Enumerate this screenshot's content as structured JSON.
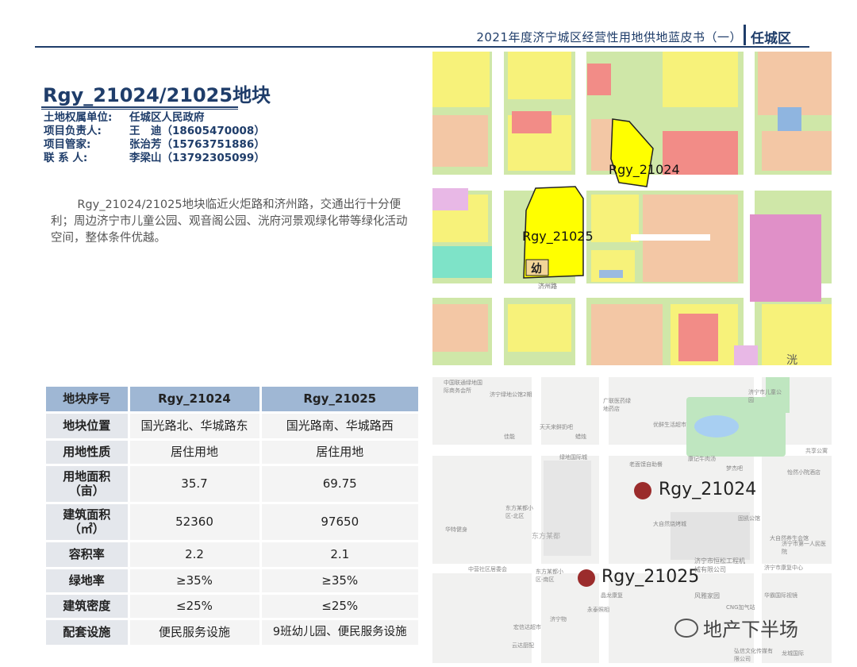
{
  "header": {
    "title": "2021年度济宁城区经营性用地供地蓝皮书（一）",
    "district": "任城区"
  },
  "plot": {
    "title": "Rgy_21024/21025地块",
    "info": [
      {
        "label": "土地权属单位:",
        "value": "任城区人民政府"
      },
      {
        "label": "项目负责人:",
        "value": "王　迪（18605470008）"
      },
      {
        "label": "项目管家:",
        "value": "张治芳（15763751886）"
      },
      {
        "label": "联 系 人:",
        "value": "李梁山（13792305099）"
      }
    ],
    "description": "Rgy_21024/21025地块临近火炬路和济州路，交通出行十分便利；周边济宁市儿童公园、观音阁公园、洸府河景观绿化带等绿化活动空间，整体条件优越。"
  },
  "table": {
    "headers": [
      "地块序号",
      "Rgy_21024",
      "Rgy_21025"
    ],
    "rows": [
      [
        "地块位置",
        "国光路北、华城路东",
        "国光路南、华城路西"
      ],
      [
        "用地性质",
        "居住用地",
        "居住用地"
      ],
      [
        "用地面积（亩）",
        "35.7",
        "69.75"
      ],
      [
        "建筑面积（㎡）",
        "52360",
        "97650"
      ],
      [
        "容积率",
        "2.2",
        "2.1"
      ],
      [
        "绿地率",
        "≥35%",
        "≥35%"
      ],
      [
        "建筑密度",
        "≤25%",
        "≤25%"
      ],
      [
        "配套设施",
        "便民服务设施",
        "9班幼儿园、便民服务设施"
      ]
    ]
  },
  "planning_map": {
    "labels": {
      "plot_a": "Rgy_21024",
      "plot_b": "Rgy_21025",
      "kindergarten": "幼",
      "river": "洸",
      "road": "济州路"
    },
    "colors": {
      "residential": "#f7f27a",
      "commercial": "#f3c7a5",
      "green": "#cfe7a8",
      "public": "#f28c87",
      "selected": "#ffff00",
      "education": "#e090c8"
    }
  },
  "location_map": {
    "labels": {
      "plot_a": "Rgy_21024",
      "plot_b": "Rgy_21025"
    },
    "pois": [
      "中国联通绿地国际商务会所",
      "济宁绿地公馆2期",
      "广联医药绿地药店",
      "天天来鲜奶吧",
      "佳能",
      "优鲜生活超市",
      "蜡烛",
      "济宁市儿童公园",
      "绿地国际城",
      "老面馍自助餐",
      "康记牛肉汤",
      "梦杰吧",
      "东方某都小区-北区",
      "东方某都",
      "大自然烧烤城",
      "固凯公馆",
      "华特健身",
      "大自然养生会馆",
      "济宁市恒松工程机械有限公司",
      "东方某都小区-南区",
      "中营社区居委会",
      "济宁市第一人民医院",
      "晶龙康复",
      "永泰照相",
      "风雅家园",
      "济宁市康复中心",
      "华霸国际视镜",
      "CNG加气站",
      "济宁物",
      "宏信达超市",
      "云达厨配",
      "龙城国际",
      "弘信文化传媒有限公司",
      "共享公寓",
      "怡然小院酒店"
    ],
    "watermark": "地产下半场"
  }
}
